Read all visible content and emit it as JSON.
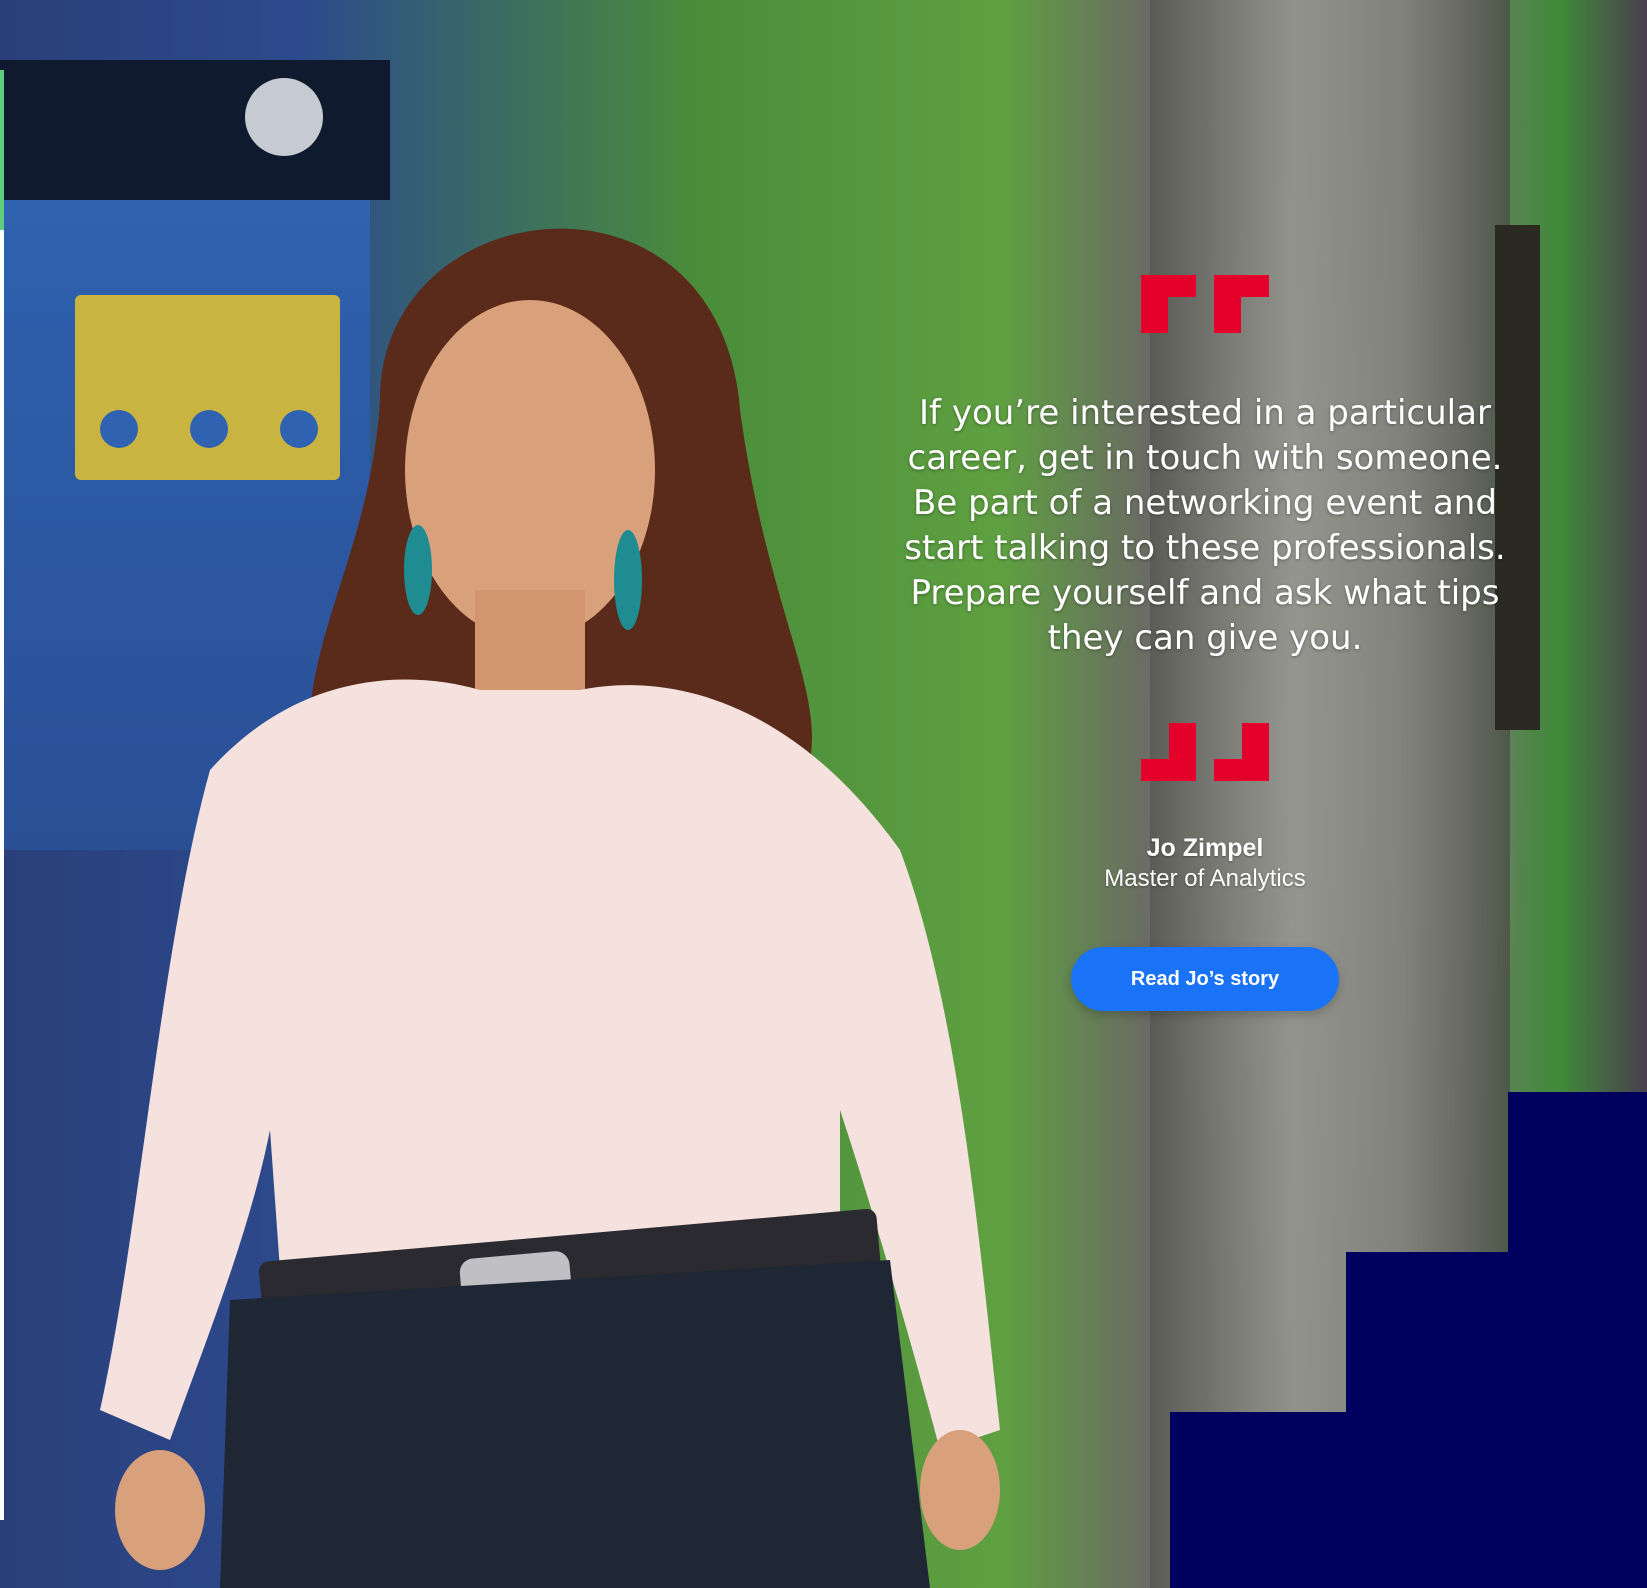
{
  "quote": {
    "text": "If you’re interested in a particular career, get in touch with someone. Be part of a networking event and start talking to these professionals. Prepare yourself and ask what tips they can give you."
  },
  "author": {
    "name": "Jo Zimpel",
    "role": "Master of Analytics"
  },
  "cta": {
    "label": "Read Jo’s story"
  },
  "colors": {
    "quote_mark": "#e4002b",
    "button": "#1a73f7",
    "navy_blocks": "#00005f"
  },
  "icons": {
    "open_quote": "open-quote-icon",
    "close_quote": "close-quote-icon"
  }
}
